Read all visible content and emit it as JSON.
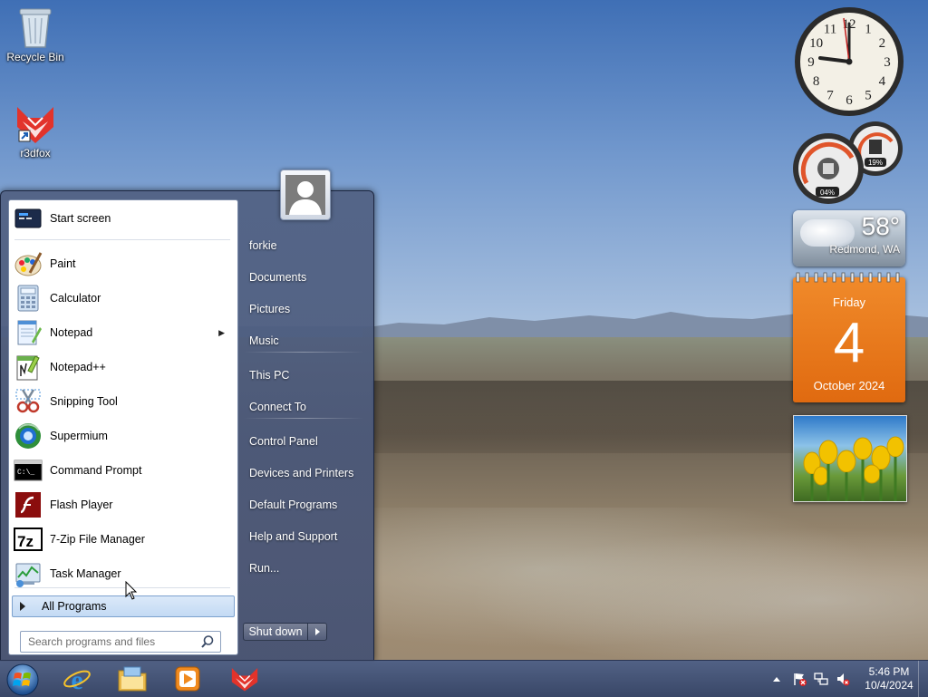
{
  "desktop": {
    "icons": [
      {
        "label": "Recycle Bin",
        "icon": "recycle-bin-icon"
      },
      {
        "label": "r3dfox",
        "icon": "r3dfox-icon"
      }
    ]
  },
  "gadgets": {
    "clock": {
      "numerals": [
        "12",
        "1",
        "2",
        "3",
        "4",
        "5",
        "6",
        "7",
        "8",
        "9",
        "10",
        "11"
      ]
    },
    "cpu_meter": {
      "cpu": "04%",
      "memory": "19%"
    },
    "weather": {
      "temperature": "58°",
      "location": "Redmond, WA"
    },
    "calendar": {
      "weekday": "Friday",
      "day": "4",
      "month_year": "October 2024"
    },
    "slideshow": {
      "subject": "yellow tulips"
    }
  },
  "start_menu": {
    "programs": [
      {
        "label": "Start screen",
        "icon": "start-screen-icon",
        "submenu": false
      },
      {
        "label": "Paint",
        "icon": "paint-icon",
        "submenu": false
      },
      {
        "label": "Calculator",
        "icon": "calculator-icon",
        "submenu": false
      },
      {
        "label": "Notepad",
        "icon": "notepad-icon",
        "submenu": true
      },
      {
        "label": "Notepad++",
        "icon": "notepad-plus-plus-icon",
        "submenu": false
      },
      {
        "label": "Snipping Tool",
        "icon": "snipping-tool-icon",
        "submenu": false
      },
      {
        "label": "Supermium",
        "icon": "supermium-icon",
        "submenu": false
      },
      {
        "label": "Command Prompt",
        "icon": "command-prompt-icon",
        "submenu": false
      },
      {
        "label": "Flash Player",
        "icon": "flash-player-icon",
        "submenu": false
      },
      {
        "label": "7-Zip File Manager",
        "icon": "seven-zip-icon",
        "submenu": false
      },
      {
        "label": "Task Manager",
        "icon": "task-manager-icon",
        "submenu": false
      }
    ],
    "all_programs": "All Programs",
    "search_placeholder": "Search programs and files",
    "right_items": [
      {
        "label": "forkie"
      },
      {
        "label": "Documents"
      },
      {
        "label": "Pictures"
      },
      {
        "label": "Music"
      },
      {
        "label": "This PC"
      },
      {
        "label": "Connect To"
      },
      {
        "label": "Control Panel"
      },
      {
        "label": "Devices and Printers"
      },
      {
        "label": "Default Programs"
      },
      {
        "label": "Help and Support"
      },
      {
        "label": "Run..."
      }
    ],
    "shutdown": "Shut down"
  },
  "taskbar": {
    "pinned": [
      {
        "icon": "internet-explorer-icon"
      },
      {
        "icon": "file-explorer-icon"
      },
      {
        "icon": "media-player-icon"
      },
      {
        "icon": "r3dfox-icon"
      }
    ],
    "tray": {
      "time": "5:46 PM",
      "date": "10/4/2024"
    }
  }
}
